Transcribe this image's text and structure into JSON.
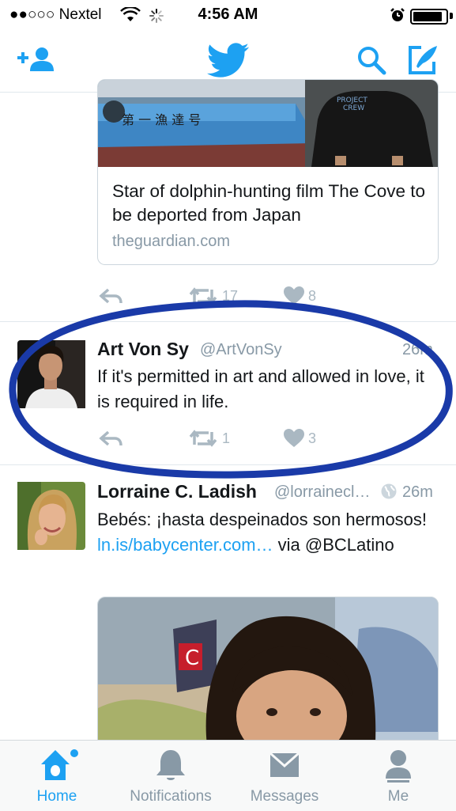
{
  "status_bar": {
    "carrier": "●●○○○ Nextel",
    "time": "4:56 AM"
  },
  "nav": {
    "icons": [
      "add-user-icon",
      "twitter-bird-icon",
      "search-icon",
      "compose-icon"
    ]
  },
  "tweets": [
    {
      "card_title": "Star of dolphin-hunting film The Cove to be deported from Japan",
      "card_domain": "theguardian.com",
      "retweets": "17",
      "likes": "8"
    },
    {
      "name": "Art Von Sy",
      "handle": "@ArtVonSy",
      "time": "26m",
      "text": "If it's permitted in art and allowed in love, it is required in life.",
      "retweets": "1",
      "likes": "3"
    },
    {
      "name": "Lorraine C. Ladish",
      "handle": "@lorrainecl…",
      "time": "26m",
      "text_1": "Bebés: ¡hasta despeinados son hermosos! ",
      "link": "ln.is/babycenter.com…",
      "text_2": " via @BCLatino"
    }
  ],
  "tabs": [
    {
      "label": "Home"
    },
    {
      "label": "Notifications"
    },
    {
      "label": "Messages"
    },
    {
      "label": "Me"
    }
  ],
  "colors": {
    "accent": "#1da1f2",
    "circle": "#1a3aa8",
    "muted": "#8899a6"
  }
}
